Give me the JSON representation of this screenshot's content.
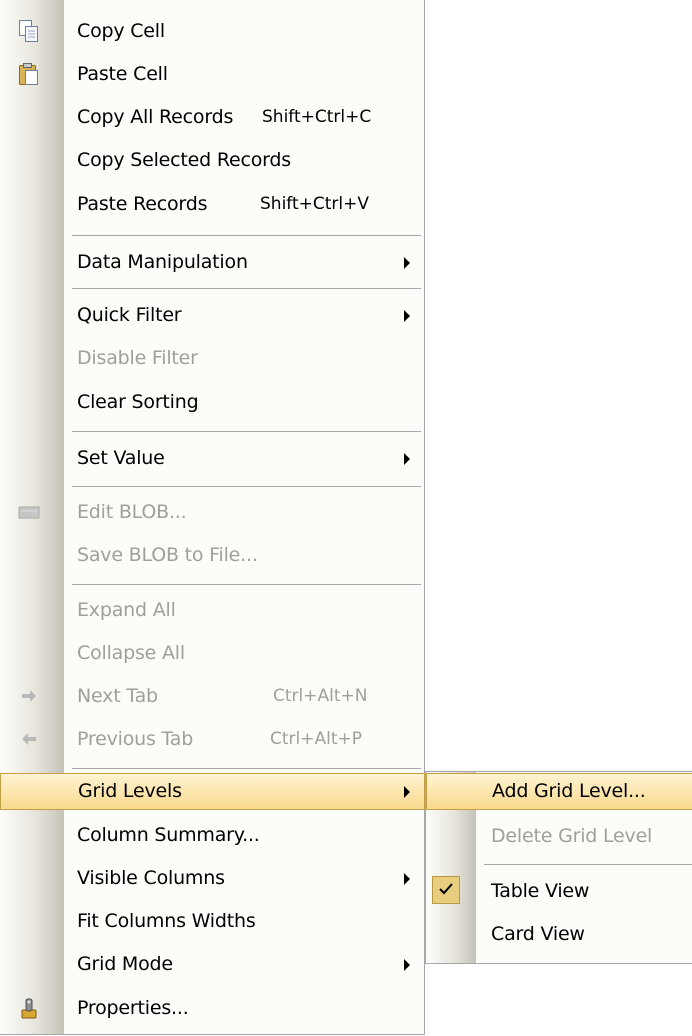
{
  "menu": {
    "items": [
      {
        "label": "Copy Cell",
        "shortcut": "",
        "submenu": false,
        "disabled": false,
        "icon": "copy-icon"
      },
      {
        "label": "Paste Cell",
        "shortcut": "",
        "submenu": false,
        "disabled": false,
        "icon": "paste-icon"
      },
      {
        "label": "Copy All Records",
        "shortcut": "Shift+Ctrl+C",
        "submenu": false,
        "disabled": false
      },
      {
        "label": "Copy Selected Records",
        "shortcut": "",
        "submenu": false,
        "disabled": false
      },
      {
        "label": "Paste Records",
        "shortcut": "Shift+Ctrl+V",
        "submenu": false,
        "disabled": false
      },
      {
        "label": "Data Manipulation",
        "shortcut": "",
        "submenu": true,
        "disabled": false
      },
      {
        "label": "Quick Filter",
        "shortcut": "",
        "submenu": true,
        "disabled": false
      },
      {
        "label": "Disable Filter",
        "shortcut": "",
        "submenu": false,
        "disabled": true
      },
      {
        "label": "Clear Sorting",
        "shortcut": "",
        "submenu": false,
        "disabled": false
      },
      {
        "label": "Set Value",
        "shortcut": "",
        "submenu": true,
        "disabled": false
      },
      {
        "label": "Edit BLOB...",
        "shortcut": "",
        "submenu": false,
        "disabled": true,
        "icon": "edit-blob-icon"
      },
      {
        "label": "Save BLOB to File...",
        "shortcut": "",
        "submenu": false,
        "disabled": true
      },
      {
        "label": "Expand All",
        "shortcut": "",
        "submenu": false,
        "disabled": true
      },
      {
        "label": "Collapse All",
        "shortcut": "",
        "submenu": false,
        "disabled": true
      },
      {
        "label": "Next Tab",
        "shortcut": "Ctrl+Alt+N",
        "submenu": false,
        "disabled": true,
        "icon": "arrow-right-icon"
      },
      {
        "label": "Previous Tab",
        "shortcut": "Ctrl+Alt+P",
        "submenu": false,
        "disabled": true,
        "icon": "arrow-left-icon"
      },
      {
        "label": "Grid Levels",
        "shortcut": "",
        "submenu": true,
        "disabled": false,
        "highlighted": true
      },
      {
        "label": "Column Summary...",
        "shortcut": "",
        "submenu": false,
        "disabled": false
      },
      {
        "label": "Visible Columns",
        "shortcut": "",
        "submenu": true,
        "disabled": false
      },
      {
        "label": "Fit Columns Widths",
        "shortcut": "",
        "submenu": false,
        "disabled": false
      },
      {
        "label": "Grid Mode",
        "shortcut": "",
        "submenu": true,
        "disabled": false
      },
      {
        "label": "Properties...",
        "shortcut": "",
        "submenu": false,
        "disabled": false,
        "icon": "properties-icon"
      }
    ]
  },
  "submenu": {
    "items": [
      {
        "label": "Add Grid Level...",
        "disabled": false,
        "highlighted": true
      },
      {
        "label": "Delete Grid Level",
        "disabled": true
      },
      {
        "label": "Table View",
        "disabled": false,
        "checked": true
      },
      {
        "label": "Card View",
        "disabled": false
      }
    ]
  },
  "colors": {
    "highlight_top": "#fff4d2",
    "highlight_bottom": "#f9d98e",
    "highlight_border": "#c2a04a",
    "disabled_text": "#a19f97",
    "separator": "#a7a6aa"
  }
}
